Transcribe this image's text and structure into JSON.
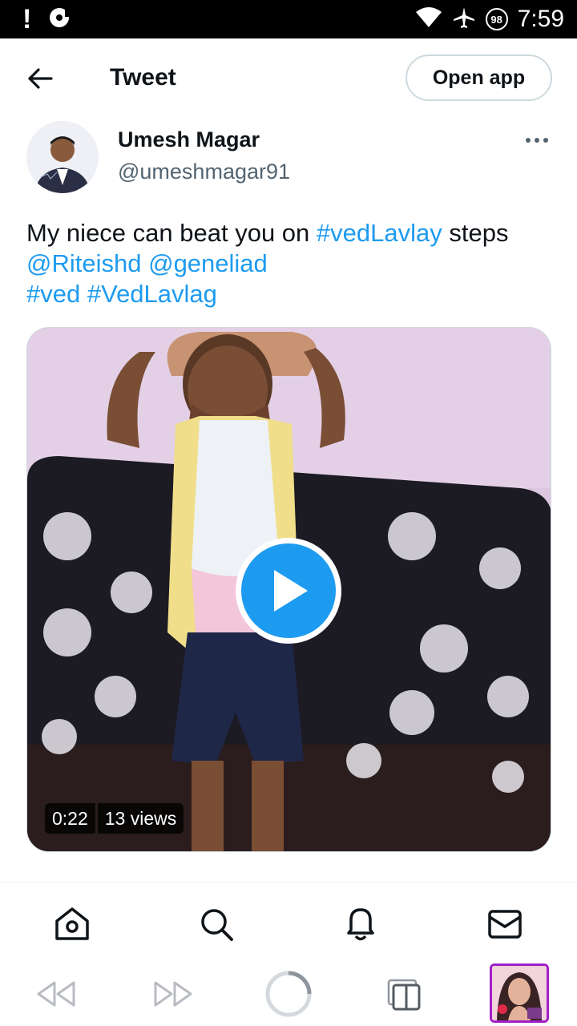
{
  "status_bar": {
    "time": "7:59",
    "battery_badge": "98",
    "alert": "!"
  },
  "header": {
    "title": "Tweet",
    "open_app_label": "Open app"
  },
  "author": {
    "name": "Umesh Magar",
    "handle": "@umeshmagar91"
  },
  "tweet": {
    "text_plain": "My niece can beat you on ",
    "hashtag_1": "#vedLavlay",
    "text_after": " steps",
    "mention_1": "@Riteishd",
    "mention_2": "@geneliad",
    "hashtag_2": "#ved",
    "hashtag_3": "#VedLavlag"
  },
  "media": {
    "duration": "0:22",
    "views": "13 views"
  },
  "colors": {
    "accent": "#1d9bf0",
    "text": "#0f1419",
    "muted": "#536471"
  },
  "icons": {
    "header": [
      "back-arrow-icon",
      "more-icon"
    ],
    "tabbar": [
      "home-icon",
      "search-icon",
      "notifications-icon",
      "messages-icon"
    ],
    "navbar": [
      "rewind-icon",
      "forward-icon",
      "loading-icon",
      "tabs-icon"
    ]
  }
}
